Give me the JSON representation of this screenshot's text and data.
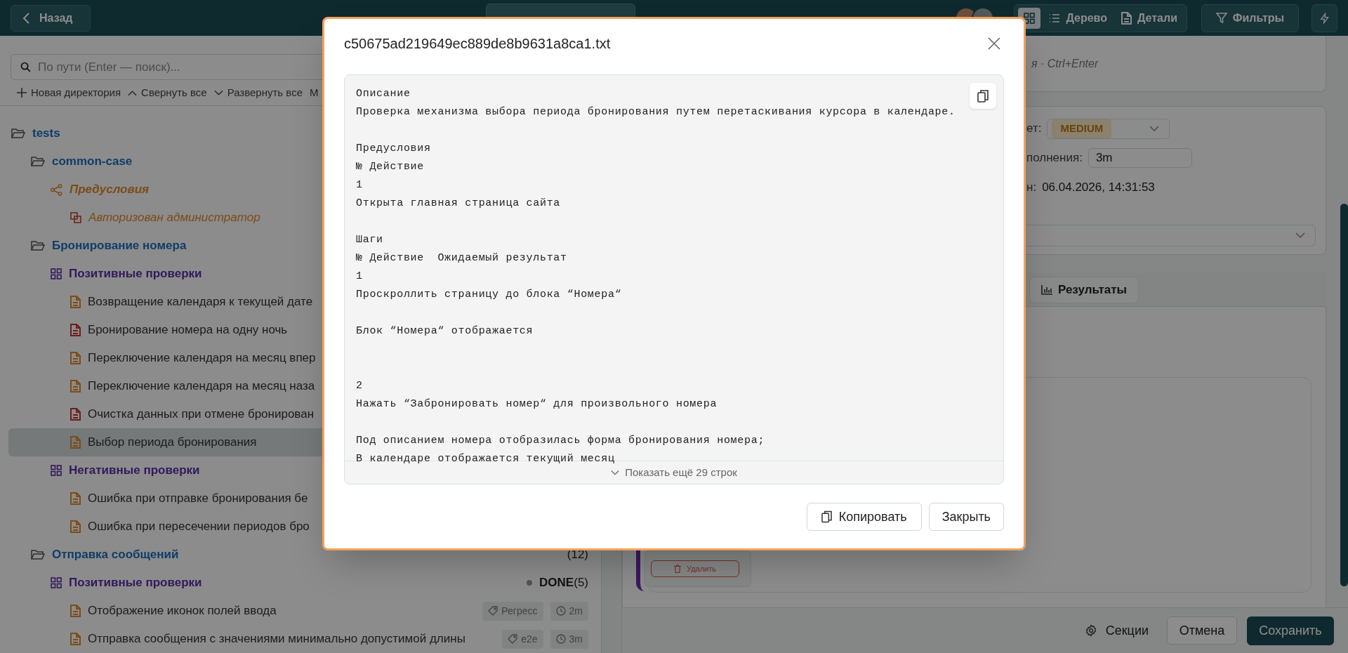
{
  "top_bar": {
    "back_button": "Назад",
    "view_tabs": [
      {
        "kind": "schema",
        "selected": true
      },
      {
        "kind": "tree",
        "label": "Дерево",
        "selected": false
      },
      {
        "kind": "details",
        "label": "Детали",
        "selected": false
      }
    ],
    "filters_button": "Фильтры"
  },
  "sidebar": {
    "search": {
      "placeholder": "По пути (Enter — поиск)..."
    },
    "toolbar": [
      {
        "kind": "add",
        "label": "Новая директория"
      },
      {
        "kind": "collapse",
        "label": "Свернуть все"
      },
      {
        "kind": "expand",
        "label": "Развернуть все"
      },
      {
        "kind": "more",
        "label": "М"
      }
    ],
    "tree": [
      {
        "kind": "folder",
        "label": "tests",
        "children": [
          {
            "kind": "folder",
            "label": "common-case",
            "children": [
              {
                "kind": "preconditions",
                "label": "Предусловия",
                "children": [
                  {
                    "kind": "precondition",
                    "label": "Авторизован администратор"
                  }
                ]
              }
            ]
          },
          {
            "kind": "folder",
            "label": "Бронирование номера",
            "children": [
              {
                "kind": "suite",
                "label": "Позитивные проверки",
                "children": [
                  {
                    "kind": "case",
                    "label": "Возвращение календаря к текущей дате",
                    "color": "#7b4c18",
                    "selected": false
                  },
                  {
                    "kind": "case",
                    "label": "Бронирование номера на одну ночь",
                    "color": "#6a1f18",
                    "selected": false
                  },
                  {
                    "kind": "case",
                    "label": "Переключение календаря на месяц впер",
                    "color": "#7b4c18",
                    "selected": false
                  },
                  {
                    "kind": "case",
                    "label": "Переключение календаря на месяц наза",
                    "color": "#7b4c18",
                    "selected": false
                  },
                  {
                    "kind": "case",
                    "label": "Очистка данных при отмене бронирован",
                    "color": "#6a1f18",
                    "selected": false
                  },
                  {
                    "kind": "case",
                    "label": "Выбор периода бронирования",
                    "color": "#7b4c18",
                    "selected": true
                  }
                ]
              },
              {
                "kind": "suite",
                "label": "Негативные проверки",
                "children": [
                  {
                    "kind": "case",
                    "label": "Ошибка при отправке бронирования бе",
                    "color": "#7b4c18",
                    "selected": false
                  },
                  {
                    "kind": "case",
                    "label": "Ошибка при пересечении периодов бро",
                    "color": "#7b4c18",
                    "selected": false
                  }
                ]
              }
            ]
          },
          {
            "kind": "folder",
            "label": "Отправка сообщений",
            "count": "(12)",
            "children": [
              {
                "kind": "suite",
                "label": "Позитивные проверки",
                "status": "DONE",
                "count": "(5)",
                "children": [
                  {
                    "kind": "case",
                    "label": "Отображение иконок полей ввода",
                    "color": "#7b4c18",
                    "selected": false,
                    "tag": "Регресс",
                    "time": "2m"
                  },
                  {
                    "kind": "case",
                    "label": "Отправка сообщения с значениями минимально допустимой длины",
                    "color": "#7b4c18",
                    "selected": false,
                    "tag": "e2e",
                    "time": "3m"
                  }
                ]
              }
            ]
          }
        ]
      }
    ]
  },
  "detail_panel": {
    "hint": "я · Ctrl+Enter",
    "fields": [
      {
        "kind": "select",
        "label": "ет:",
        "value": "MEDIUM"
      },
      {
        "kind": "input",
        "label": "полнения:",
        "value": "3m"
      },
      {
        "kind": "text",
        "label": "н:",
        "value": "06.04.2026, 14:31:53"
      },
      {
        "kind": "wide_select"
      }
    ],
    "results_tab": "Результаты",
    "delete_button": "Удалить",
    "sections_button": "Секции",
    "cancel_button": "Отмена",
    "save_button": "Сохранить"
  },
  "dialog": {
    "title": "c50675ad219649ec889de8b9631a8ca1.txt",
    "content": "Описание\nПроверка механизма выбора периода бронирования путем перетаскивания курсора в календаре.\n\nПредусловия\n№ Действие\n1\nОткрыта главная страница сайта\n\nШаги\n№ Действие  Ожидаемый результат\n1\nПроскроллить страницу до блока “Номера“\n\nБлок “Номера“ отображается\n\n\n2\nНажать “Забронировать номер“ для произвольного номера\n\nПод описанием номера отобразилась форма бронирования номера;\nВ календаре отображается текущий месяц",
    "show_more": "Показать ещё 29 строк",
    "buttons": [
      {
        "kind": "copy",
        "label": "Копировать"
      },
      {
        "kind": "close",
        "label": "Закрыть"
      }
    ]
  }
}
